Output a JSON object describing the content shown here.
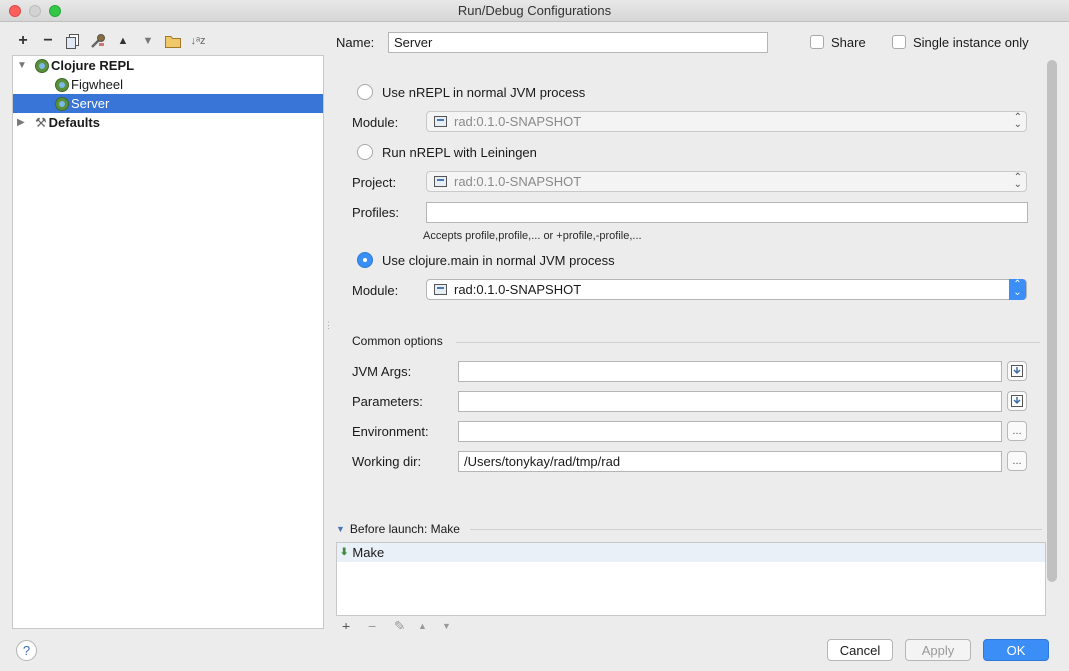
{
  "window": {
    "title": "Run/Debug Configurations"
  },
  "toolbar": {
    "icons": [
      "add-icon",
      "remove-icon",
      "copy-icon",
      "wrench-icon",
      "move-up-icon",
      "move-down-icon",
      "folder-icon",
      "sort-icon"
    ],
    "add_glyph": "+",
    "remove_glyph": "−",
    "up_glyph": "▲",
    "down_glyph": "▼",
    "sort_glyph": "↓ᵃz"
  },
  "tree": {
    "group_label": "Clojure REPL",
    "children": [
      "Figwheel",
      "Server"
    ],
    "selected": "Server",
    "defaults_label": "Defaults"
  },
  "form": {
    "name_label": "Name:",
    "name_value": "Server",
    "share_label": "Share",
    "single_instance_label": "Single instance only",
    "opt1_label": "Use nREPL in normal JVM process",
    "module1_label": "Module:",
    "module1_value": "rad:0.1.0-SNAPSHOT",
    "opt2_label": "Run nREPL with Leiningen",
    "project_label": "Project:",
    "project_value": "rad:0.1.0-SNAPSHOT",
    "profiles_label": "Profiles:",
    "profiles_value": "",
    "profiles_hint": "Accepts profile,profile,... or +profile,-profile,...",
    "opt3_label": "Use clojure.main in normal JVM process",
    "module3_label": "Module:",
    "module3_value": "rad:0.1.0-SNAPSHOT",
    "selected_option": 3
  },
  "common": {
    "header": "Common options",
    "jvm_args_label": "JVM Args:",
    "jvm_args_value": "",
    "parameters_label": "Parameters:",
    "parameters_value": "",
    "environment_label": "Environment:",
    "environment_value": "",
    "working_dir_label": "Working dir:",
    "working_dir_value": "/Users/tonykay/rad/tmp/rad",
    "ellipsis": "..."
  },
  "before_launch": {
    "header": "Before launch: Make",
    "items": [
      "Make"
    ],
    "tools": [
      "+",
      "−",
      "✎",
      "▲",
      "▼"
    ]
  },
  "buttons": {
    "help": "?",
    "cancel": "Cancel",
    "apply": "Apply",
    "ok": "OK"
  },
  "colors": {
    "accent": "#3b8ef5",
    "selection": "#3875d7"
  }
}
